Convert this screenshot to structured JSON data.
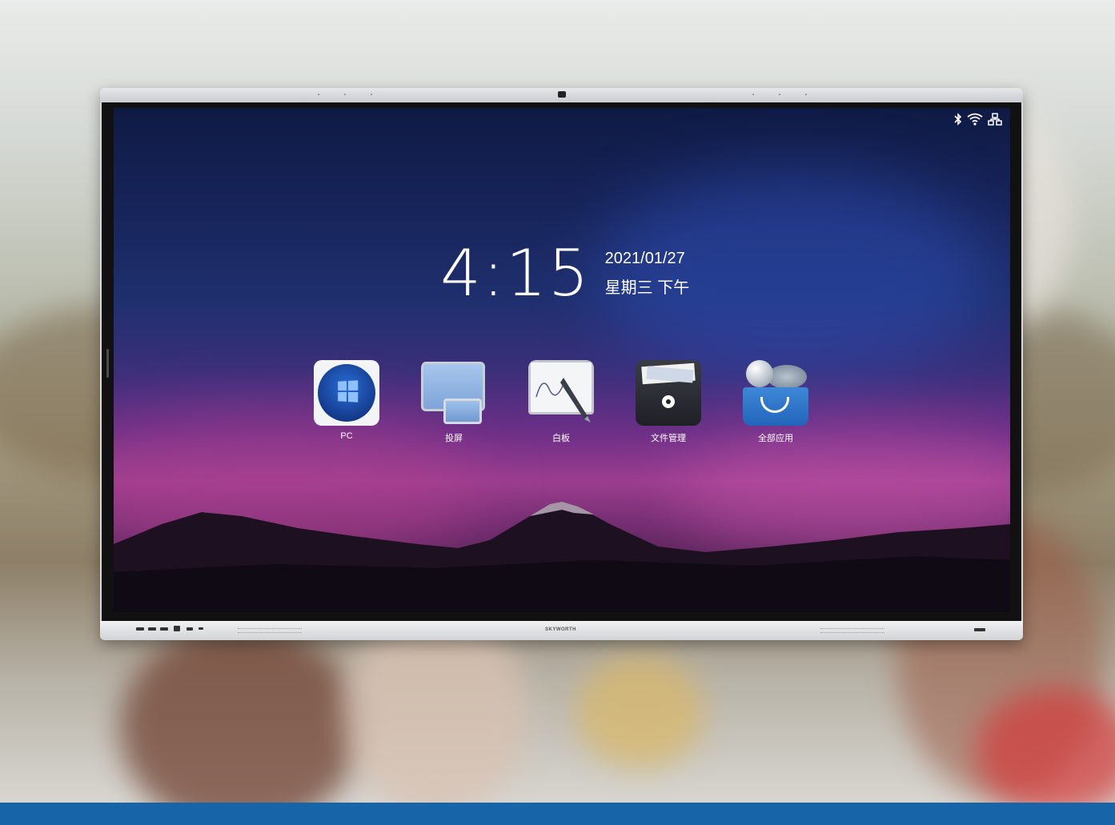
{
  "status_icons": [
    "bluetooth-icon",
    "wifi-icon",
    "network-icon"
  ],
  "clock": {
    "time": "4:15",
    "date": "2021/01/27",
    "weekday": "星期三  下午"
  },
  "apps": [
    {
      "label": "PC",
      "icon": "windows-pc-icon"
    },
    {
      "label": "投屏",
      "icon": "screen-cast-icon"
    },
    {
      "label": "白板",
      "icon": "whiteboard-icon"
    },
    {
      "label": "文件管理",
      "icon": "file-manager-icon"
    },
    {
      "label": "全部应用",
      "icon": "all-apps-icon"
    }
  ],
  "monitor": {
    "brand": "SKYWORTH"
  },
  "colors": {
    "bottom_bar": "#1764a8",
    "screen_top": "#0f1a44",
    "screen_mid": "#9b3d8f"
  }
}
